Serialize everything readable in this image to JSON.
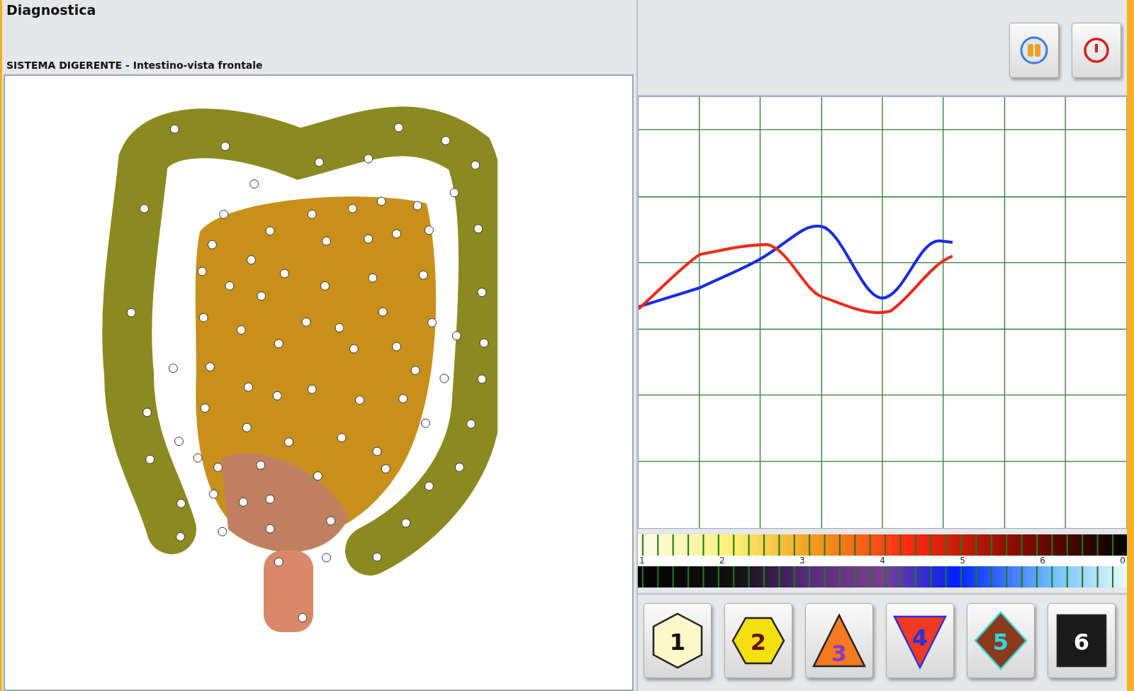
{
  "window": {
    "title": "Diagnostica"
  },
  "organ_view": {
    "caption": "SISTEMA DIGERENTE - Intestino-vista frontale"
  },
  "toolbar": {
    "buttons": [
      {
        "kind": "pause"
      },
      {
        "kind": "power"
      }
    ]
  },
  "scale": {
    "labels": [
      "1",
      "2",
      "3",
      "4",
      "5",
      "6",
      "0"
    ]
  },
  "level_buttons": [
    {
      "label": "1",
      "kind": "hexagon",
      "color": "#fff8c8"
    },
    {
      "label": "2",
      "kind": "hexagon-flat",
      "color": "#f2e010"
    },
    {
      "label": "3",
      "kind": "triangle",
      "color": "#f57a20"
    },
    {
      "label": "4",
      "kind": "triangle-down",
      "color": "#f03a20"
    },
    {
      "label": "5",
      "kind": "diamond",
      "color": "#8a3a1a"
    },
    {
      "label": "6",
      "kind": "square",
      "color": "#1a1a1a"
    }
  ]
}
